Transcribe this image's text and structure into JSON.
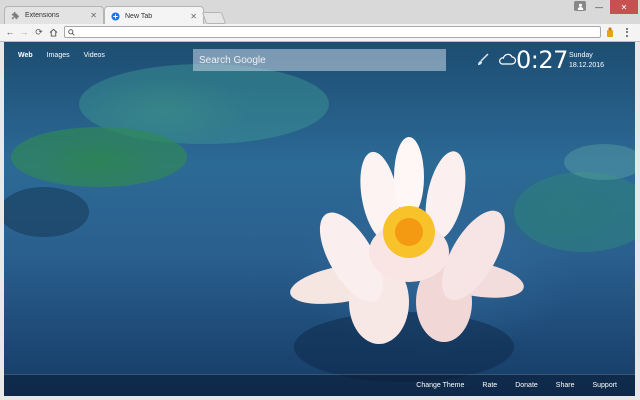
{
  "tabs": [
    {
      "label": "Extensions",
      "icon": "puzzle-icon",
      "active": false
    },
    {
      "label": "New Tab",
      "icon": "globe-icon",
      "active": true
    }
  ],
  "toolbar": {
    "omnibox_value": ""
  },
  "page": {
    "links": [
      "Web",
      "Images",
      "Videos"
    ],
    "search_placeholder": "Search Google",
    "time": "0:27",
    "day": "Sunday",
    "date": "18.12.2016",
    "footer": [
      "Change Theme",
      "Rate",
      "Donate",
      "Share",
      "Support"
    ]
  },
  "colors": {
    "accent_blue": "#1a73e8",
    "close_red": "#c75050"
  }
}
